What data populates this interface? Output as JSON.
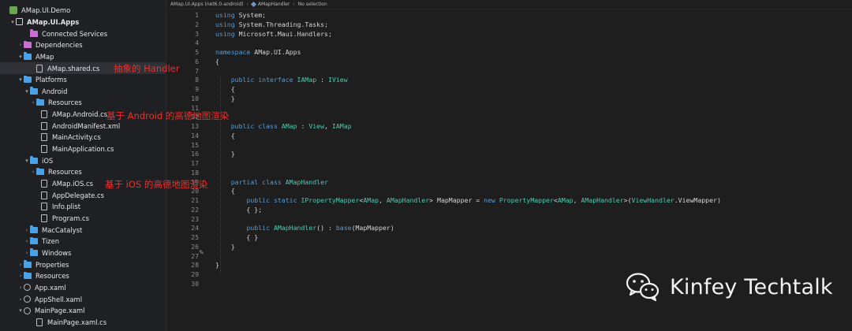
{
  "explorer": {
    "items": [
      {
        "label": "AMap.UI.Demo",
        "chevron": "",
        "icon": "solution"
      },
      {
        "label": "AMap.UI.Apps",
        "chevron": "▾",
        "icon": "project",
        "bold": true
      },
      {
        "label": "Connected Services",
        "chevron": "",
        "icon": "folder-pink"
      },
      {
        "label": "Dependencies",
        "chevron": "›",
        "icon": "folder-pink"
      },
      {
        "label": "AMap",
        "chevron": "▾",
        "icon": "folder"
      },
      {
        "label": "AMap.shared.cs",
        "chevron": "",
        "icon": "file",
        "selected": true
      },
      {
        "label": "Platforms",
        "chevron": "▾",
        "icon": "folder"
      },
      {
        "label": "Android",
        "chevron": "▾",
        "icon": "folder"
      },
      {
        "label": "Resources",
        "chevron": "›",
        "icon": "folder"
      },
      {
        "label": "AMap.Android.cs",
        "chevron": "",
        "icon": "file"
      },
      {
        "label": "AndroidManifest.xml",
        "chevron": "",
        "icon": "file"
      },
      {
        "label": "MainActivity.cs",
        "chevron": "",
        "icon": "file"
      },
      {
        "label": "MainApplication.cs",
        "chevron": "",
        "icon": "file"
      },
      {
        "label": "iOS",
        "chevron": "▾",
        "icon": "folder"
      },
      {
        "label": "Resources",
        "chevron": "›",
        "icon": "folder"
      },
      {
        "label": "AMap.iOS.cs",
        "chevron": "",
        "icon": "file"
      },
      {
        "label": "AppDelegate.cs",
        "chevron": "",
        "icon": "file"
      },
      {
        "label": "Info.plist",
        "chevron": "",
        "icon": "file"
      },
      {
        "label": "Program.cs",
        "chevron": "",
        "icon": "file"
      },
      {
        "label": "MacCatalyst",
        "chevron": "›",
        "icon": "folder"
      },
      {
        "label": "Tizen",
        "chevron": "›",
        "icon": "folder"
      },
      {
        "label": "Windows",
        "chevron": "›",
        "icon": "folder"
      },
      {
        "label": "Properties",
        "chevron": "›",
        "icon": "folder"
      },
      {
        "label": "Resources",
        "chevron": "›",
        "icon": "folder"
      },
      {
        "label": "App.xaml",
        "chevron": "›",
        "icon": "gear"
      },
      {
        "label": "AppShell.xaml",
        "chevron": "›",
        "icon": "gear"
      },
      {
        "label": "MainPage.xaml",
        "chevron": "▾",
        "icon": "gear"
      },
      {
        "label": "MainPage.xaml.cs",
        "chevron": "",
        "icon": "file"
      }
    ]
  },
  "breadcrumb": {
    "project": "AMap.UI.Apps (net6.0-android)",
    "type": "AMapHandler",
    "member": "No selection"
  },
  "code": {
    "lines": [
      [
        {
          "t": "using ",
          "c": "kw"
        },
        {
          "t": "System;"
        }
      ],
      [
        {
          "t": "using ",
          "c": "kw"
        },
        {
          "t": "System.Threading.Tasks;"
        }
      ],
      [
        {
          "t": "using ",
          "c": "kw"
        },
        {
          "t": "Microsoft.Maui.Handlers;"
        }
      ],
      [],
      [
        {
          "t": "namespace ",
          "c": "kw"
        },
        {
          "t": "AMap.UI.Apps"
        }
      ],
      [
        {
          "t": "{"
        }
      ],
      [],
      [
        {
          "t": "    "
        },
        {
          "t": "public interface ",
          "c": "kw"
        },
        {
          "t": "IAMap",
          "c": "ty"
        },
        {
          "t": " : "
        },
        {
          "t": "IView",
          "c": "ty"
        }
      ],
      [
        {
          "t": "    {"
        }
      ],
      [
        {
          "t": "    }"
        }
      ],
      [],
      [],
      [
        {
          "t": "    "
        },
        {
          "t": "public class ",
          "c": "kw"
        },
        {
          "t": "AMap",
          "c": "ty"
        },
        {
          "t": " : "
        },
        {
          "t": "View",
          "c": "ty"
        },
        {
          "t": ", "
        },
        {
          "t": "IAMap",
          "c": "ty"
        }
      ],
      [
        {
          "t": "    {"
        }
      ],
      [],
      [
        {
          "t": "    }"
        }
      ],
      [],
      [],
      [
        {
          "t": "    "
        },
        {
          "t": "partial class ",
          "c": "kw"
        },
        {
          "t": "AMapHandler",
          "c": "ty"
        }
      ],
      [
        {
          "t": "    {"
        }
      ],
      [
        {
          "t": "        "
        },
        {
          "t": "public static ",
          "c": "kw"
        },
        {
          "t": "IPropertyMapper",
          "c": "ty"
        },
        {
          "t": "<"
        },
        {
          "t": "AMap",
          "c": "ty"
        },
        {
          "t": ", "
        },
        {
          "t": "AMapHandler",
          "c": "ty"
        },
        {
          "t": "> MapMapper = "
        },
        {
          "t": "new ",
          "c": "kw"
        },
        {
          "t": "PropertyMapper",
          "c": "ty"
        },
        {
          "t": "<"
        },
        {
          "t": "AMap",
          "c": "ty"
        },
        {
          "t": ", "
        },
        {
          "t": "AMapHandler",
          "c": "ty"
        },
        {
          "t": ">("
        },
        {
          "t": "ViewHandler",
          "c": "ty"
        },
        {
          "t": ".ViewMapper)"
        }
      ],
      [
        {
          "t": "        { };"
        }
      ],
      [],
      [
        {
          "t": "        "
        },
        {
          "t": "public ",
          "c": "kw"
        },
        {
          "t": "AMapHandler",
          "c": "ty"
        },
        {
          "t": "() : "
        },
        {
          "t": "base",
          "c": "kw"
        },
        {
          "t": "(MapMapper)"
        }
      ],
      [
        {
          "t": "        { }"
        }
      ],
      [
        {
          "t": "    }"
        }
      ],
      [],
      [
        {
          "t": "}"
        }
      ],
      [],
      []
    ]
  },
  "annotations": {
    "abstract_handler": "抽象的 Handler",
    "android_handler": "基于 Android 的高德地图渲染",
    "ios_handler": "基于 iOS 的高德地图渲染"
  },
  "watermark": {
    "text": "Kinfey Techtalk",
    "icon": "wechat-icon"
  },
  "colors": {
    "keyword": "#569cd6",
    "type": "#4ec9b0",
    "annotation": "#e8332f",
    "folder": "#4aa3e8"
  }
}
